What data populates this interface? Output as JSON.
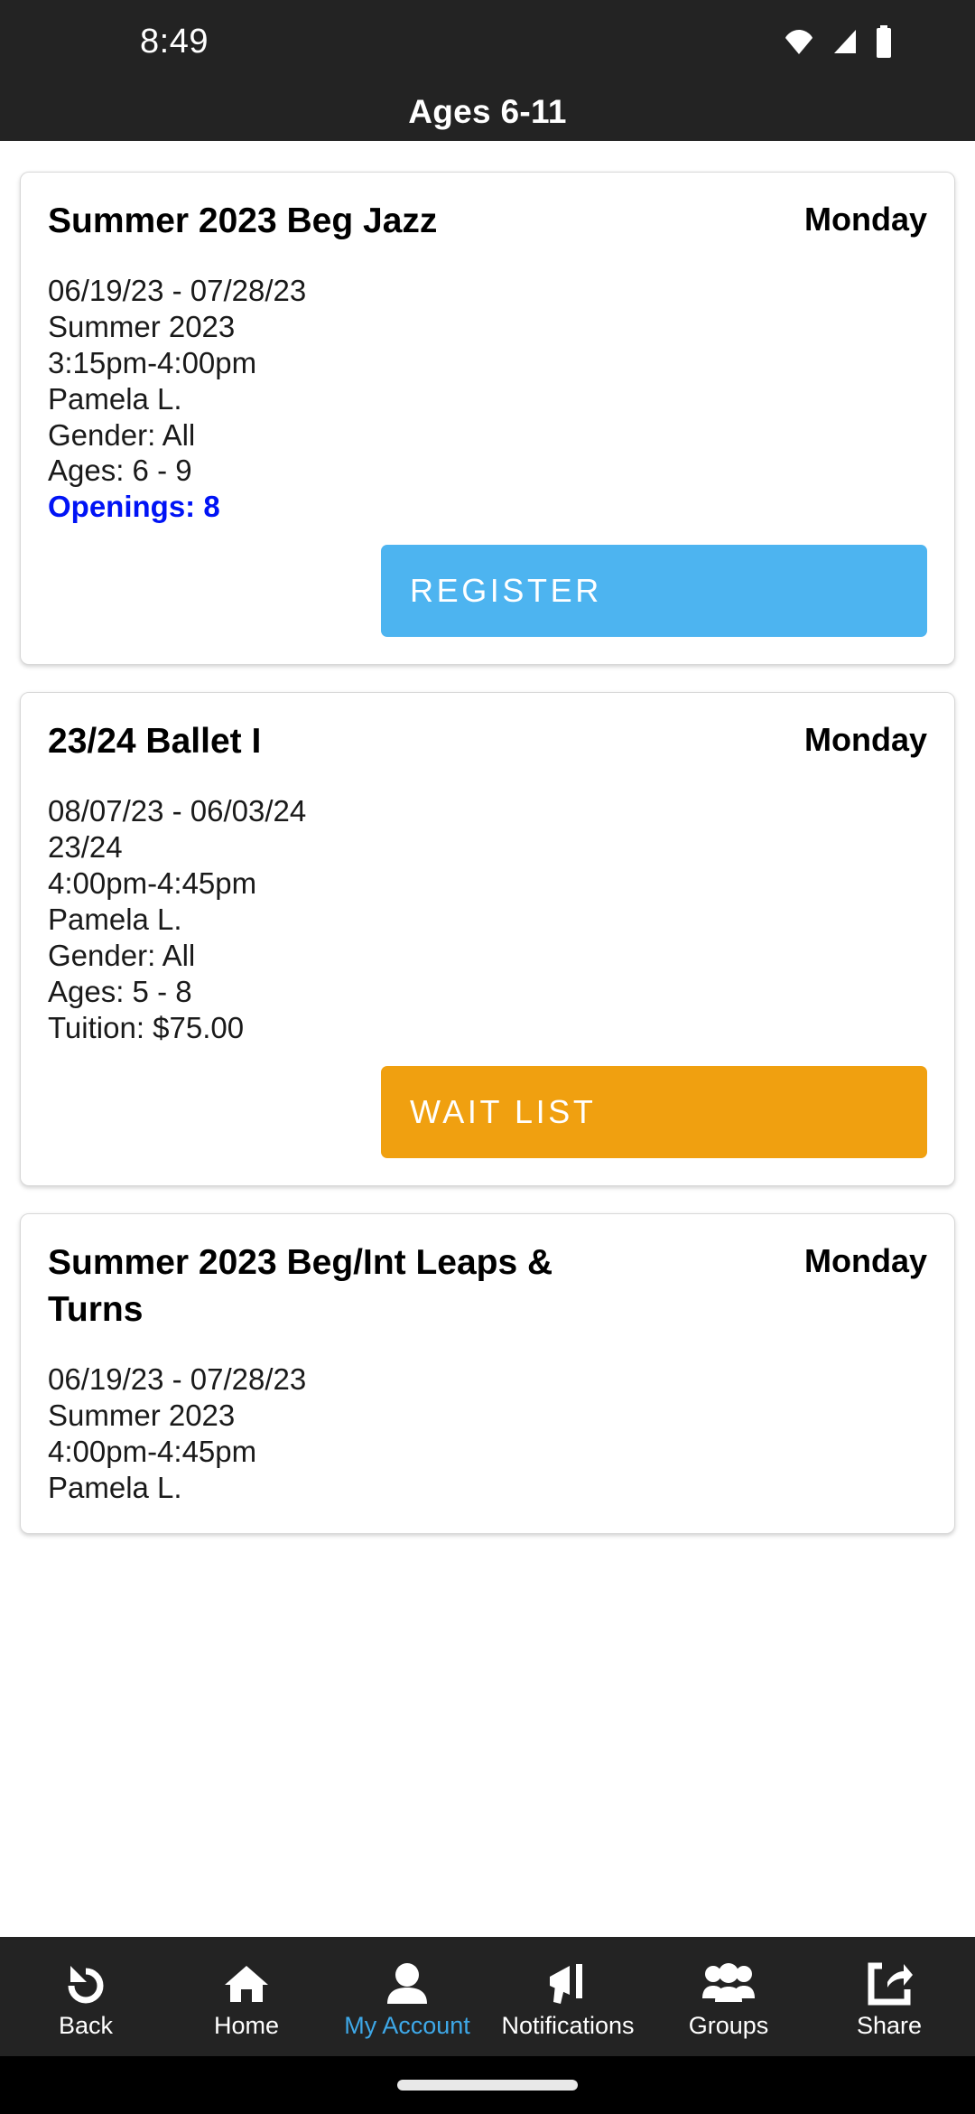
{
  "status_bar": {
    "time": "8:49",
    "icons": [
      "wifi-icon",
      "signal-icon",
      "battery-icon"
    ]
  },
  "header": {
    "title": "Ages 6-11"
  },
  "colors": {
    "bar_background": "#232323",
    "register_button": "#4db4f0",
    "waitlist_button": "#f0a010",
    "openings_text": "#0013f5",
    "active_nav": "#3ea8e8"
  },
  "classes": [
    {
      "title": "Summer 2023 Beg Jazz",
      "day": "Monday",
      "details": [
        "06/19/23 - 07/28/23",
        "Summer 2023",
        "3:15pm-4:00pm",
        "Pamela L.",
        "Gender: All",
        "Ages: 6 - 9"
      ],
      "highlight": "Openings: 8",
      "button_label": "REGISTER",
      "button_type": "register"
    },
    {
      "title": "23/24 Ballet I",
      "day": "Monday",
      "details": [
        "08/07/23 - 06/03/24",
        "23/24",
        "4:00pm-4:45pm",
        "Pamela L.",
        "Gender: All",
        "Ages: 5 - 8",
        "Tuition: $75.00"
      ],
      "highlight": "",
      "button_label": "WAIT LIST",
      "button_type": "waitlist"
    },
    {
      "title": "Summer 2023 Beg/Int Leaps & Turns",
      "day": "Monday",
      "details": [
        "06/19/23 - 07/28/23",
        "Summer 2023",
        "4:00pm-4:45pm",
        "Pamela L."
      ],
      "highlight": "",
      "button_label": "",
      "button_type": "none"
    }
  ],
  "bottom_nav": [
    {
      "label": "Back",
      "icon": "undo-arrow-icon",
      "active": false
    },
    {
      "label": "Home",
      "icon": "house-icon",
      "active": false
    },
    {
      "label": "My Account",
      "icon": "person-icon",
      "active": true
    },
    {
      "label": "Notifications",
      "icon": "megaphone-icon",
      "active": false
    },
    {
      "label": "Groups",
      "icon": "people-group-icon",
      "active": false
    },
    {
      "label": "Share",
      "icon": "share-icon",
      "active": false
    }
  ]
}
